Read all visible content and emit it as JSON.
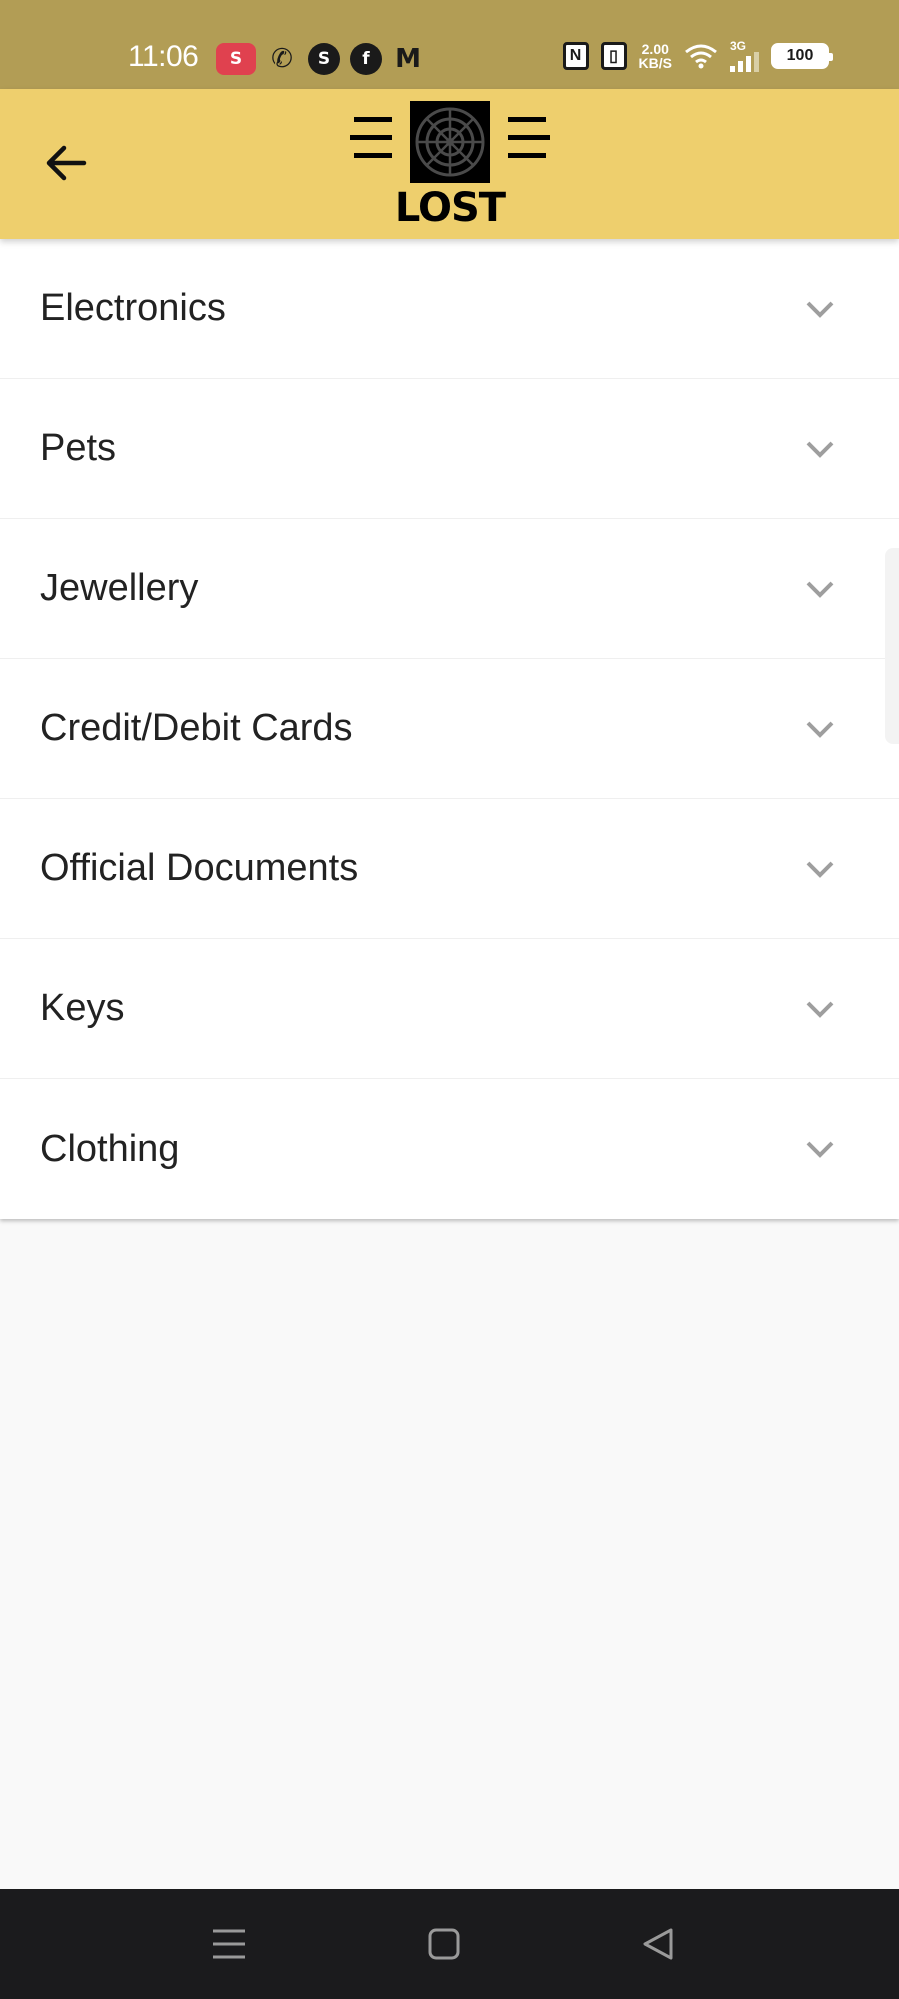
{
  "status_bar": {
    "time": "11:06",
    "network_speed_value": "2.00",
    "network_speed_unit": "KB/S",
    "network_type": "3G",
    "battery": "100"
  },
  "app_bar": {
    "logo_text": "LOST"
  },
  "categories": [
    {
      "label": "Electronics"
    },
    {
      "label": "Pets"
    },
    {
      "label": "Jewellery"
    },
    {
      "label": "Credit/Debit Cards"
    },
    {
      "label": "Official Documents"
    },
    {
      "label": "Keys"
    },
    {
      "label": "Clothing"
    }
  ],
  "colors": {
    "status_bar": "#b29d55",
    "app_bar": "#eecf6d",
    "chevron": "#9e9e9e",
    "nav_bar": "#1b1b1d"
  }
}
